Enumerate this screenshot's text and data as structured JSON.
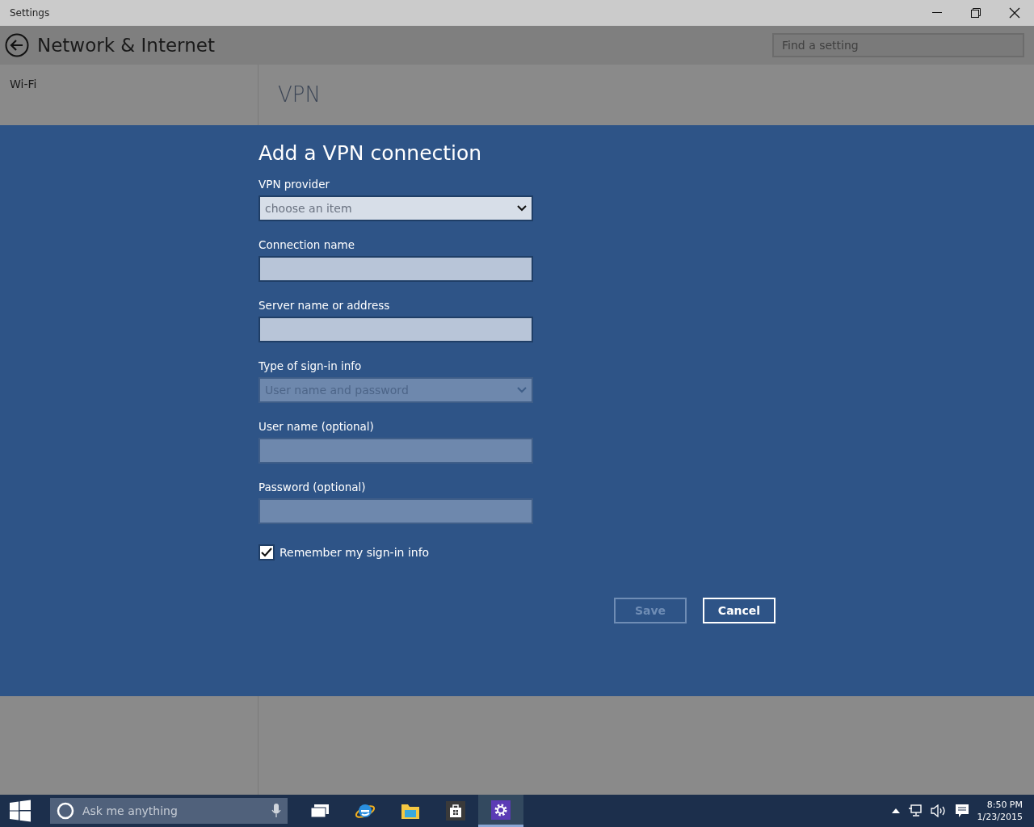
{
  "window": {
    "title": "Settings"
  },
  "header": {
    "title": "Network & Internet",
    "search": {
      "placeholder": "Find a setting"
    }
  },
  "sidebar": {
    "items": [
      {
        "label": "Wi-Fi"
      }
    ]
  },
  "page": {
    "title": "VPN"
  },
  "dialog": {
    "title": "Add a VPN connection",
    "fields": [
      {
        "kind": "dropdown",
        "label": "VPN provider",
        "placeholder": "choose an item",
        "disabled": false
      },
      {
        "kind": "text",
        "label": "Connection name",
        "disabled": false
      },
      {
        "kind": "text",
        "label": "Server name or address",
        "disabled": false
      },
      {
        "kind": "dropdown",
        "label": "Type of sign-in info",
        "value": "User name and password",
        "disabled": true
      },
      {
        "kind": "text",
        "label": "User name (optional)",
        "disabled": true
      },
      {
        "kind": "text",
        "label": "Password (optional)",
        "disabled": true
      }
    ],
    "checkbox": {
      "label": "Remember my sign-in info",
      "checked": true
    },
    "buttons": [
      {
        "label": "Save",
        "disabled": true
      },
      {
        "label": "Cancel",
        "disabled": false
      }
    ]
  },
  "taskbar": {
    "search": {
      "placeholder": "Ask me anything"
    },
    "apps": [
      {
        "kind": "taskview",
        "selected": false
      },
      {
        "kind": "browser",
        "selected": false
      },
      {
        "kind": "folder",
        "selected": false
      },
      {
        "kind": "store",
        "selected": false
      },
      {
        "kind": "settings",
        "selected": true
      }
    ],
    "time": "8:50 PM",
    "date": "1/23/2015"
  }
}
